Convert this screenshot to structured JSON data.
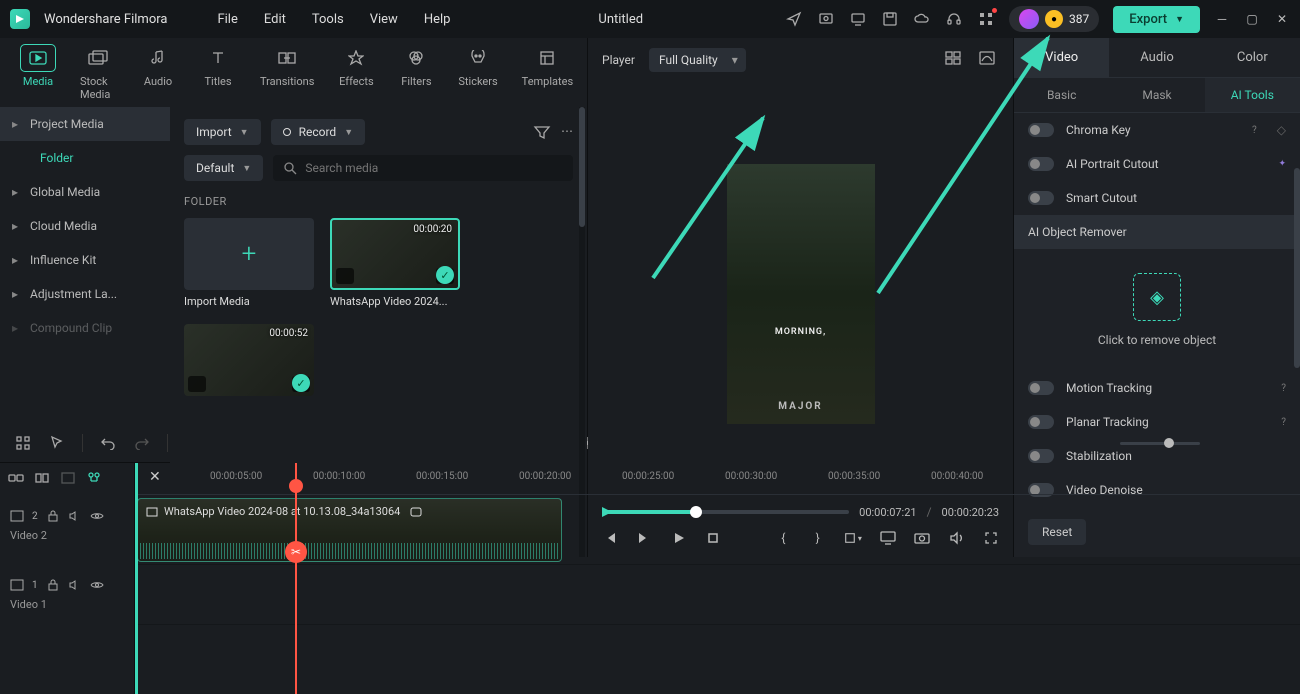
{
  "app": {
    "title": "Wondershare Filmora",
    "docTitle": "Untitled"
  },
  "menus": [
    "File",
    "Edit",
    "Tools",
    "View",
    "Help"
  ],
  "credits": {
    "value": "387"
  },
  "export": {
    "label": "Export"
  },
  "modeTabs": [
    {
      "label": "Media",
      "active": true
    },
    {
      "label": "Stock Media"
    },
    {
      "label": "Audio"
    },
    {
      "label": "Titles"
    },
    {
      "label": "Transitions"
    },
    {
      "label": "Effects"
    },
    {
      "label": "Filters"
    },
    {
      "label": "Stickers"
    },
    {
      "label": "Templates"
    }
  ],
  "sidebar": {
    "items": [
      {
        "label": "Project Media",
        "active": true
      },
      {
        "label": "Folder",
        "sub": true,
        "folder": true
      },
      {
        "label": "Global Media"
      },
      {
        "label": "Cloud Media"
      },
      {
        "label": "Influence Kit"
      },
      {
        "label": "Adjustment La..."
      },
      {
        "label": "Compound Clip",
        "faded": true
      }
    ]
  },
  "browser": {
    "importLabel": "Import",
    "recordLabel": "Record",
    "sortLabel": "Default",
    "searchPlaceholder": "Search media",
    "folderHeader": "FOLDER",
    "media": [
      {
        "name": "Import Media",
        "type": "add"
      },
      {
        "name": "WhatsApp Video 2024...",
        "type": "video",
        "dur": "00:00:20",
        "selected": true
      },
      {
        "name": "",
        "type": "video",
        "dur": "00:00:52"
      }
    ]
  },
  "player": {
    "label": "Player",
    "quality": "Full Quality",
    "overlay1": "MORNING,",
    "overlay2": "MAJOR",
    "current": "00:00:07:21",
    "total": "00:00:20:23",
    "sep": "/"
  },
  "inspector": {
    "tabs": [
      {
        "label": "Video",
        "active": true
      },
      {
        "label": "Audio"
      },
      {
        "label": "Color"
      }
    ],
    "subtabs": [
      {
        "label": "Basic"
      },
      {
        "label": "Mask"
      },
      {
        "label": "AI Tools",
        "active": true
      }
    ],
    "tools": [
      {
        "name": "Chroma Key",
        "help": true
      },
      {
        "name": "AI Portrait Cutout",
        "star": true
      },
      {
        "name": "Smart Cutout"
      },
      {
        "name": "AI Object Remover",
        "hl": true,
        "noToggle": true
      }
    ],
    "removeLabel": "Click to remove object",
    "tools2": [
      {
        "name": "Motion Tracking",
        "help": true
      },
      {
        "name": "Planar Tracking",
        "help": true
      },
      {
        "name": "Stabilization"
      },
      {
        "name": "Video Denoise"
      }
    ],
    "reset": "Reset"
  },
  "timeline": {
    "ticks": [
      "00:00:05:00",
      "00:00:10:00",
      "00:00:15:00",
      "00:00:20:00",
      "00:00:25:00",
      "00:00:30:00",
      "00:00:35:00",
      "00:00:40:00"
    ],
    "tracks": [
      {
        "labelNum": "2",
        "name": "Video 2"
      },
      {
        "labelNum": "1",
        "name": "Video 1"
      }
    ],
    "clipLabel": "WhatsApp Video 2024-08 at 10.13.08_34a13064"
  }
}
